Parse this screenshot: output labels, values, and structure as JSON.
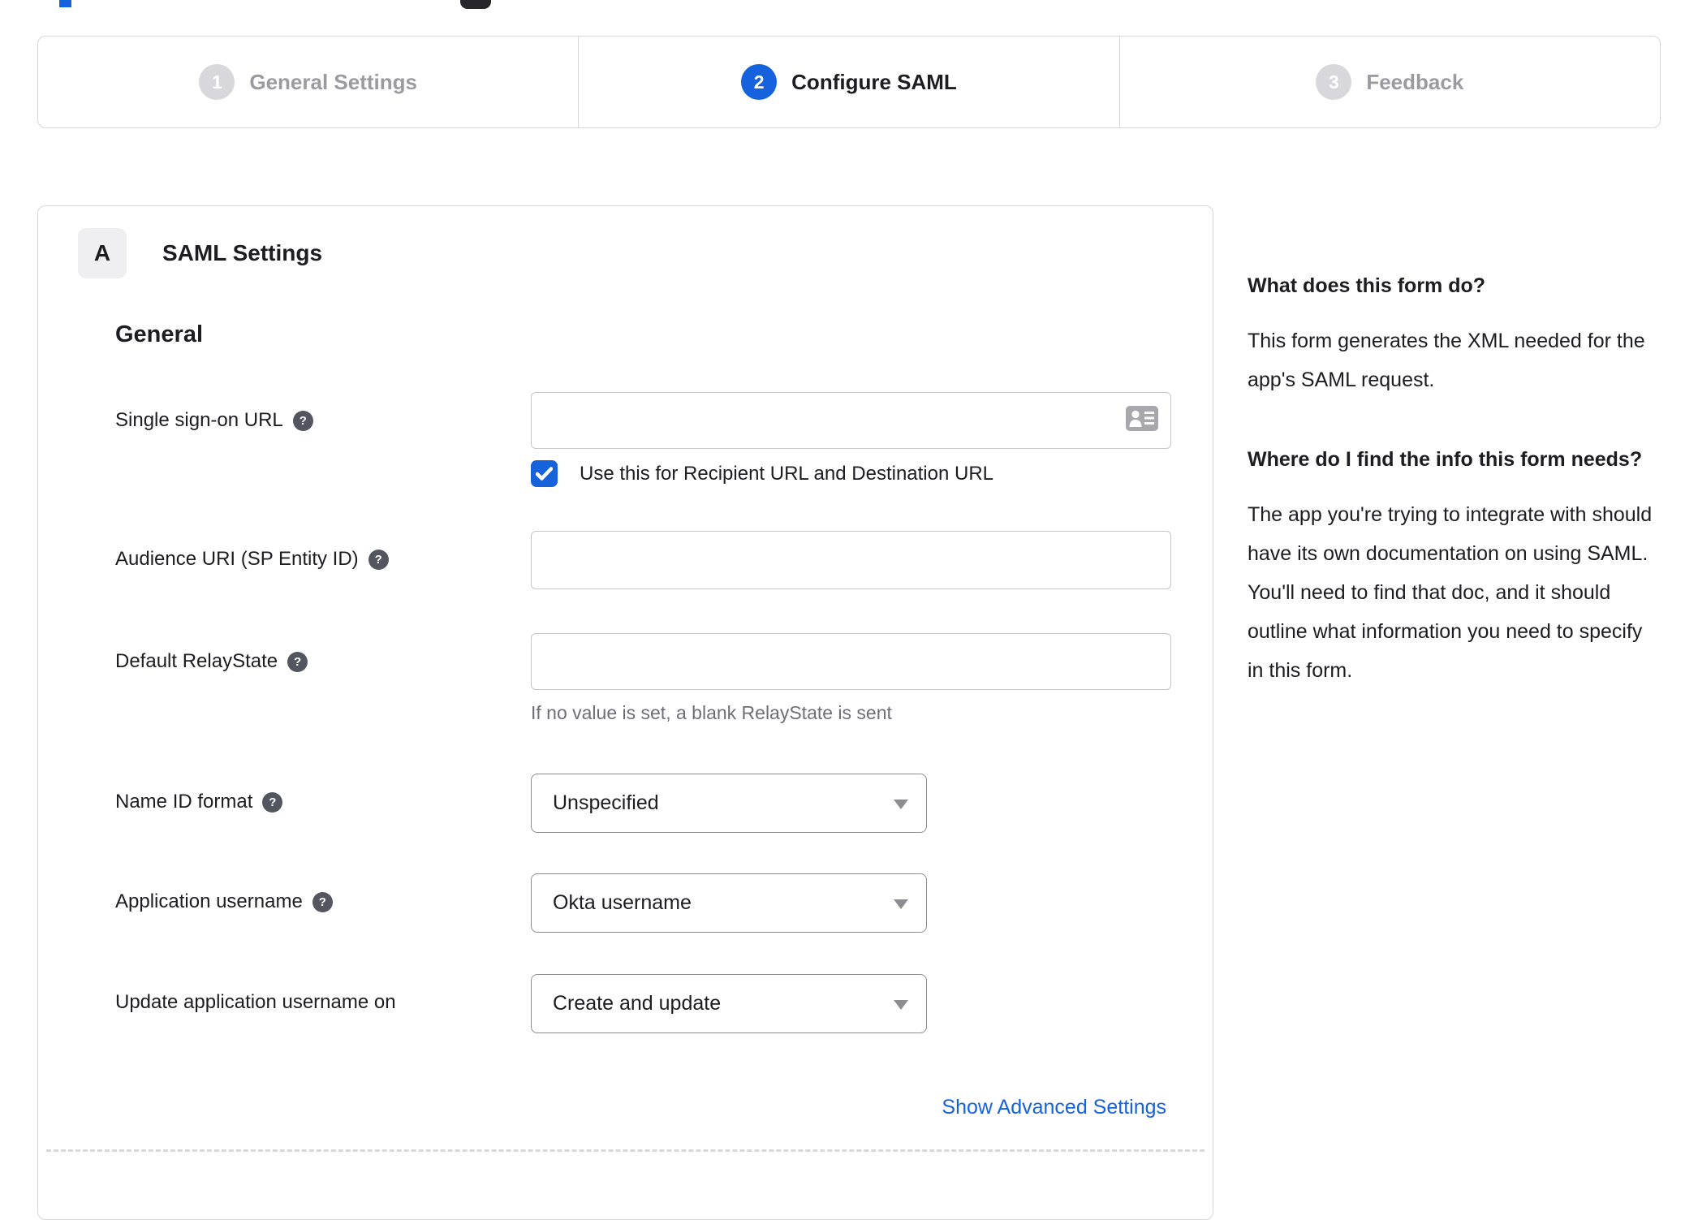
{
  "colors": {
    "accent_blue": "#1662dd",
    "inactive_gray": "#d7d7dc",
    "text_dark": "#1d1d21",
    "text_gray": "#9a9aa0",
    "help_icon_bg": "#54565f",
    "link_blue": "#1662dd"
  },
  "stepper": {
    "steps": [
      {
        "number": "1",
        "label": "General Settings",
        "state": "inactive"
      },
      {
        "number": "2",
        "label": "Configure SAML",
        "state": "active"
      },
      {
        "number": "3",
        "label": "Feedback",
        "state": "inactive"
      }
    ]
  },
  "panel": {
    "section_badge": "A",
    "section_title": "SAML Settings",
    "group_heading": "General",
    "fields": [
      {
        "label": "Single sign-on URL",
        "type": "text",
        "value": "",
        "has_help": true,
        "trailing_icon": "contact-card-icon",
        "checkbox": {
          "checked": true,
          "label": "Use this for Recipient URL and Destination URL"
        }
      },
      {
        "label": "Audience URI (SP Entity ID)",
        "type": "text",
        "value": "",
        "has_help": true
      },
      {
        "label": "Default RelayState",
        "type": "text",
        "value": "",
        "has_help": true,
        "hint": "If no value is set, a blank RelayState is sent"
      },
      {
        "label": "Name ID format",
        "type": "select",
        "value": "Unspecified",
        "has_help": true
      },
      {
        "label": "Application username",
        "type": "select",
        "value": "Okta username",
        "has_help": true
      },
      {
        "label": "Update application username on",
        "type": "select",
        "value": "Create and update",
        "has_help": false
      }
    ],
    "show_advanced_label": "Show Advanced Settings"
  },
  "sidebar": {
    "sections": [
      {
        "heading": "What does this form do?",
        "body": "This form generates the XML needed for the app's SAML request."
      },
      {
        "heading": "Where do I find the info this form needs?",
        "body": "The app you're trying to integrate with should have its own documentation on using SAML. You'll need to find that doc, and it should outline what information you need to specify in this form."
      }
    ]
  }
}
